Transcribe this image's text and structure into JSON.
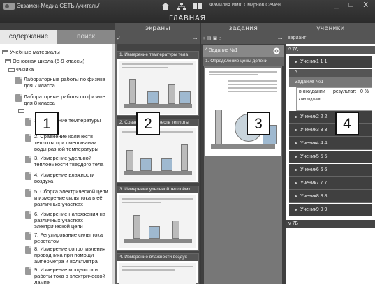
{
  "window": {
    "title": "Экзамен-Медиа СЕТЬ /учитель/",
    "user_label": "Фамилия Имя:  Смирнов Семен",
    "controls": "_ □ X",
    "main_label": "ГЛАВНАЯ"
  },
  "left_panel": {
    "tabs": [
      {
        "label": "содержание",
        "active": true
      },
      {
        "label": "поиск",
        "active": false
      }
    ],
    "tree": {
      "root": "Учебные материалы",
      "school": "Основная школа (5-9 классы)",
      "subject": "Физика",
      "folders": [
        "Лабораторные работы по физике для 7 класса",
        "Лабораторные работы по физике для 8 класса"
      ],
      "items": [
        "1. Измерение температуры",
        "2. Сравнение количеств теплоты при смешивании воды разной температуры",
        "3. Измерение удельной теплоёмкости твердого тела",
        "4. Измерение влажности воздуха",
        "5. Сборка электрической цепи и измерение силы тока в её различных участках",
        "6. Измерение напряжения на различных участках электрической цепи",
        "7. Регулирование силы тока реостатом",
        "8. Измерение сопротивления проводника при помощи амперметра и вольтметра",
        "9. Измерение мощности и работы тока в электрической лампе"
      ]
    }
  },
  "screens_panel": {
    "title": "экраны",
    "check": "✓",
    "arrow": "→",
    "slides": [
      "1. Измерение температуры тела",
      "2. Сравнение количеств теплоты",
      "3. Измерение удельной теплоёмк",
      "4. Измерение влажности воздух"
    ]
  },
  "tasks_panel": {
    "title": "задания",
    "toolbar": "+ ▤ ▣ ⌂",
    "arrow": "→",
    "task_title": "Задание №1",
    "task_subtitle": "1. Определение цены делени"
  },
  "students_panel": {
    "title": "ученики",
    "variant_label": "вариант",
    "groups": [
      "7А",
      "7Б"
    ],
    "students": [
      "Ученик1 1 1",
      "Ученик2 2 2",
      "Ученик3 3 3",
      "Ученик4 4 4",
      "Ученик5 5 5",
      "Ученик6 6 6",
      "Ученик7 7 7",
      "Ученик8 8 8",
      "Ученик9 9 9"
    ],
    "detail": {
      "task": "Задание №1",
      "status": "в ожидании",
      "result_label": "результат:",
      "result_value": "0 %",
      "type_label": "•Тип задания: Т"
    }
  },
  "callouts": [
    "1",
    "2",
    "3",
    "4"
  ]
}
